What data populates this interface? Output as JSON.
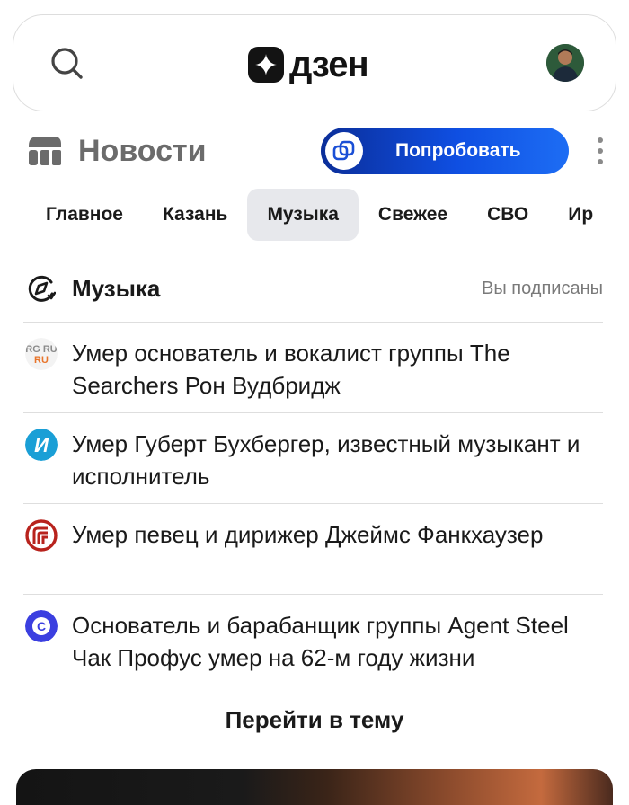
{
  "header": {
    "logo_text": "дзен",
    "search_icon": "search-icon",
    "avatar": "user-avatar"
  },
  "section": {
    "title": "Новости",
    "icon": "news-icon",
    "try_button_label": "Попробовать",
    "try_button_icon": "overlapping-squares-icon",
    "more_icon": "more-vertical-icon"
  },
  "tabs": [
    {
      "label": "Главное",
      "active": false
    },
    {
      "label": "Казань",
      "active": false
    },
    {
      "label": "Музыка",
      "active": true
    },
    {
      "label": "Свежее",
      "active": false
    },
    {
      "label": "СВО",
      "active": false
    },
    {
      "label": "Ир",
      "active": false
    }
  ],
  "topic": {
    "title": "Музыка",
    "icon": "topic-compass-icon",
    "status": "Вы подписаны",
    "news": [
      {
        "source": "RG RU",
        "source_icon": "rg-ru-logo-icon",
        "text": "Умер основатель и вокалист группы The Searchers Рон Вудбридж"
      },
      {
        "source": "И",
        "source_icon": "i-source-logo-icon",
        "text": "Умер Губерт Бухбергер, известный музыкант и исполнитель"
      },
      {
        "source": "",
        "source_icon": "red-rings-logo-icon",
        "text": "Умер певец и дирижер Джеймс Фанкхаузер"
      },
      {
        "source": "C",
        "source_icon": "c-source-logo-icon",
        "text": "Основатель и барабанщик группы Agent Steel Чак Профус умер на 62-м году жизни"
      }
    ],
    "goto_label": "Перейти в тему"
  },
  "colors": {
    "accent_blue": "#0f4fe2",
    "tab_active_bg": "#e7e8ec",
    "muted_text": "#7a7a7a",
    "divider": "#dedede"
  }
}
